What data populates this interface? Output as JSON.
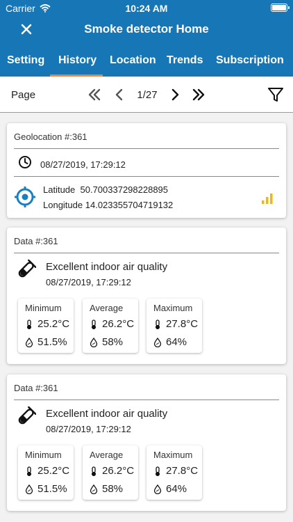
{
  "status": {
    "carrier": "Carrier",
    "time": "10:24 AM"
  },
  "header": {
    "title": "Smoke detector Home",
    "close_label": "✕"
  },
  "tabs": [
    "Setting",
    "History",
    "Location",
    "Trends",
    "Subscription"
  ],
  "active_tab": "History",
  "pager": {
    "label": "Page",
    "current": "1/27"
  },
  "geolocation": {
    "heading": "Geolocation #:361",
    "timestamp": "08/27/2019, 17:29:12",
    "latitude_label": "Latitude",
    "latitude": "50.700337298228895",
    "longitude_label": "Longitude",
    "longitude": "14.023355704719132"
  },
  "data_cards": [
    {
      "heading": "Data #:361",
      "title": "Excellent indoor air quality",
      "timestamp": "08/27/2019, 17:29:12",
      "stats": [
        {
          "label": "Minimum",
          "temperature": "25.2°C",
          "humidity": "51.5%"
        },
        {
          "label": "Average",
          "temperature": "26.2°C",
          "humidity": "58%"
        },
        {
          "label": "Maximum",
          "temperature": "27.8°C",
          "humidity": "64%"
        }
      ]
    },
    {
      "heading": "Data #:361",
      "title": "Excellent indoor air quality",
      "timestamp": "08/27/2019, 17:29:12",
      "stats": [
        {
          "label": "Minimum",
          "temperature": "25.2°C",
          "humidity": "51.5%"
        },
        {
          "label": "Average",
          "temperature": "26.2°C",
          "humidity": "58%"
        },
        {
          "label": "Maximum",
          "temperature": "27.8°C",
          "humidity": "64%"
        }
      ]
    }
  ],
  "colors": {
    "primary": "#1676b6",
    "accent": "#ff7f2a",
    "signal": "#f5b800",
    "target": "#1a7fc1"
  },
  "icons": [
    "wifi-icon",
    "battery-icon",
    "close-icon",
    "double-chevron-left-icon",
    "chevron-left-icon",
    "chevron-right-icon",
    "double-chevron-right-icon",
    "filter-icon",
    "clock-icon",
    "target-icon",
    "signal-icon",
    "test-tube-icon",
    "thermometer-icon",
    "droplet-icon"
  ]
}
